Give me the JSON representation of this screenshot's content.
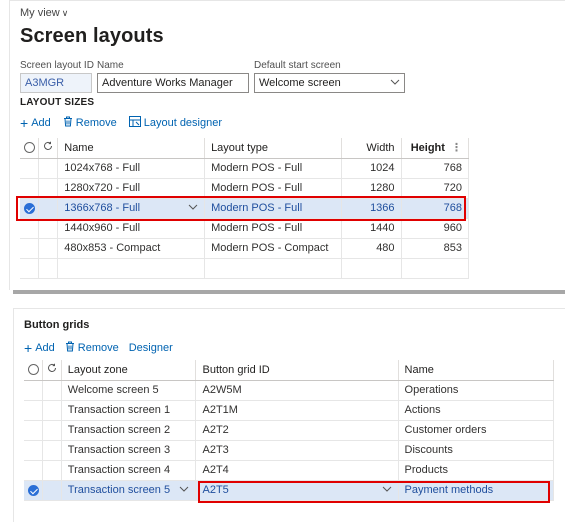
{
  "header": {
    "view_label": "My view",
    "view_caret": "∨",
    "title": "Screen layouts"
  },
  "form": {
    "id_label": "Screen layout ID",
    "id_value": "A3MGR",
    "name_label": "Name",
    "name_value": "Adventure Works Manager",
    "start_label": "Default start screen",
    "start_value": "Welcome screen"
  },
  "layout_sizes": {
    "heading": "LAYOUT SIZES",
    "actions": {
      "add": "Add",
      "remove": "Remove",
      "designer": "Layout designer"
    },
    "columns": {
      "name": "Name",
      "type": "Layout type",
      "width": "Width",
      "height": "Height"
    },
    "rows": [
      {
        "name": "1024x768 - Full",
        "type": "Modern POS - Full",
        "width": "1024",
        "height": "768"
      },
      {
        "name": "1280x720 - Full",
        "type": "Modern POS - Full",
        "width": "1280",
        "height": "720"
      },
      {
        "name": "1366x768 - Full",
        "type": "Modern POS - Full",
        "width": "1366",
        "height": "768"
      },
      {
        "name": "1440x960 - Full",
        "type": "Modern POS - Full",
        "width": "1440",
        "height": "960"
      },
      {
        "name": "480x853 - Compact",
        "type": "Modern POS - Compact",
        "width": "480",
        "height": "853"
      }
    ]
  },
  "button_grids": {
    "heading": "Button grids",
    "actions": {
      "add": "Add",
      "remove": "Remove",
      "designer": "Designer"
    },
    "columns": {
      "zone": "Layout zone",
      "grid_id": "Button grid ID",
      "name": "Name"
    },
    "rows": [
      {
        "zone": "Welcome screen 5",
        "grid_id": "A2W5M",
        "name": "Operations"
      },
      {
        "zone": "Transaction screen 1",
        "grid_id": "A2T1M",
        "name": "Actions"
      },
      {
        "zone": "Transaction screen 2",
        "grid_id": "A2T2",
        "name": "Customer orders"
      },
      {
        "zone": "Transaction screen 3",
        "grid_id": "A2T3",
        "name": "Discounts"
      },
      {
        "zone": "Transaction screen 4",
        "grid_id": "A2T4",
        "name": "Products"
      },
      {
        "zone": "Transaction screen 5",
        "grid_id": "A2T5",
        "name": "Payment methods"
      }
    ]
  },
  "colors": {
    "accent": "#0063b1",
    "selected_row": "#dce7f6",
    "highlight": "#e00000"
  }
}
